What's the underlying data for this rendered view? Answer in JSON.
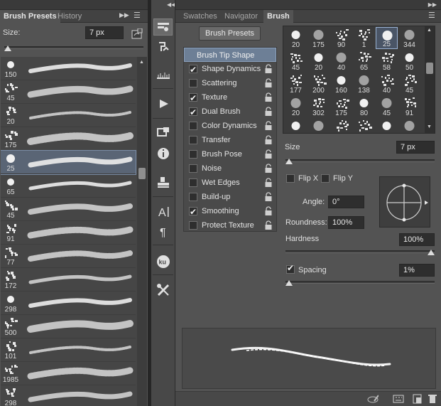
{
  "left_panel": {
    "tabs": [
      "Brush Presets",
      "History"
    ],
    "size_label": "Size:",
    "size_value": "7 px",
    "size_level": 0.0,
    "presets": [
      {
        "num": "150"
      },
      {
        "num": "45"
      },
      {
        "num": "20"
      },
      {
        "num": "175"
      },
      {
        "num": "25",
        "selected": true
      },
      {
        "num": "65"
      },
      {
        "num": "45"
      },
      {
        "num": "91"
      },
      {
        "num": "77"
      },
      {
        "num": "172"
      },
      {
        "num": "298"
      },
      {
        "num": "500"
      },
      {
        "num": "101"
      },
      {
        "num": "1985"
      },
      {
        "num": "298"
      }
    ]
  },
  "tool_strip": {
    "tools": [
      "brush-settings-icon",
      "clone-source-icon",
      "brush-presets-icon",
      "play-icon",
      "3d-icon",
      "info-icon",
      "stamp-icon",
      "character-icon",
      "paragraph-icon",
      "kuler-icon",
      "tools-icon"
    ]
  },
  "right_panel": {
    "tabs": [
      "Swatches",
      "Navigator",
      "Brush"
    ],
    "brush_presets_button": "Brush Presets",
    "options_header": "Brush Tip Shape",
    "options": [
      {
        "label": "Shape Dynamics",
        "checked": true
      },
      {
        "label": "Scattering",
        "checked": false
      },
      {
        "label": "Texture",
        "checked": true
      },
      {
        "label": "Dual Brush",
        "checked": true
      },
      {
        "label": "Color Dynamics",
        "checked": false
      },
      {
        "label": "Transfer",
        "checked": false
      },
      {
        "label": "Brush Pose",
        "checked": false
      },
      {
        "label": "Noise",
        "checked": false
      },
      {
        "label": "Wet Edges",
        "checked": false
      },
      {
        "label": "Build-up",
        "checked": false
      },
      {
        "label": "Smoothing",
        "checked": true
      },
      {
        "label": "Protect Texture",
        "checked": false
      }
    ],
    "tips": [
      [
        "20",
        "175",
        "90",
        "1",
        "25",
        "344"
      ],
      [
        "45",
        "20",
        "40",
        "65",
        "58",
        "50"
      ],
      [
        "177",
        "200",
        "160",
        "138",
        "40",
        "45"
      ],
      [
        "20",
        "302",
        "175",
        "80",
        "45",
        "91"
      ],
      [
        "",
        "",
        "",
        "",
        "",
        ""
      ]
    ],
    "selected_tip_index": 4,
    "size_label": "Size",
    "size_value": "7 px",
    "size_level": 0.0,
    "flip_x_label": "Flip X",
    "flip_y_label": "Flip Y",
    "flip_x": false,
    "flip_y": false,
    "angle_label": "Angle:",
    "angle_value": "0°",
    "roundness_label": "Roundness:",
    "roundness_value": "100%",
    "hardness_label": "Hardness",
    "hardness_value": "100%",
    "hardness_level": 1.0,
    "spacing_label": "Spacing",
    "spacing_checked": true,
    "spacing_value": "1%",
    "spacing_level": 0.0
  },
  "colors": {
    "panel": "#535353",
    "selection": "#6d7f96",
    "field": "#2e2e2e"
  }
}
